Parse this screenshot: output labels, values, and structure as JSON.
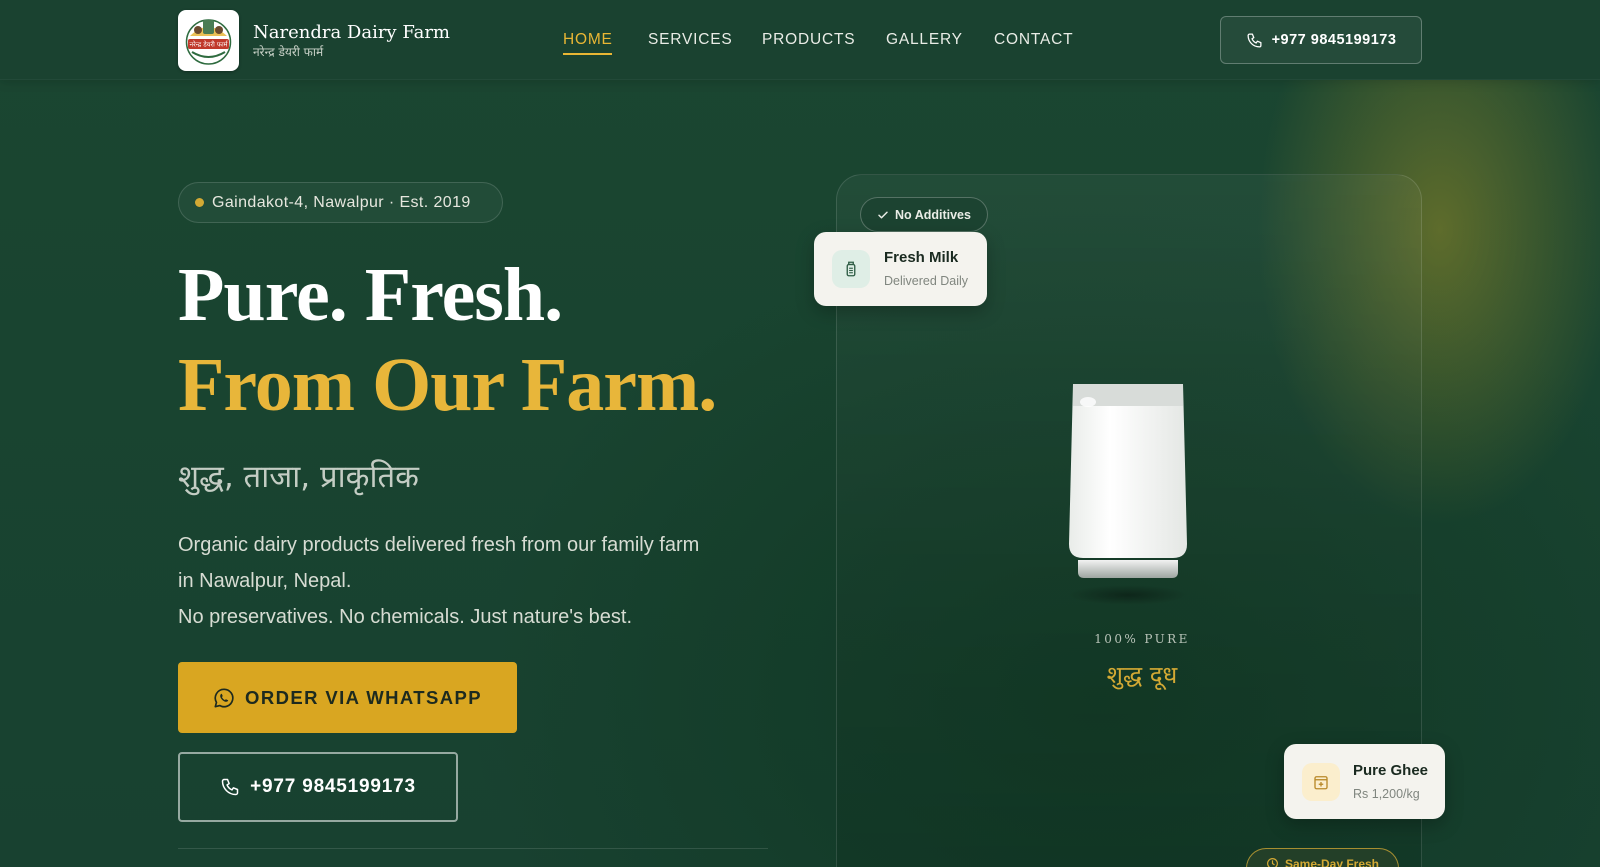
{
  "brand": {
    "name": "Narendra Dairy Farm",
    "subtitle": "नरेन्द्र डेयरी फार्म",
    "logo_text": "नरेन्द्र डेयरी फार्म"
  },
  "nav": {
    "items": [
      {
        "label": "HOME",
        "active": true
      },
      {
        "label": "SERVICES",
        "active": false
      },
      {
        "label": "PRODUCTS",
        "active": false
      },
      {
        "label": "GALLERY",
        "active": false
      },
      {
        "label": "CONTACT",
        "active": false
      }
    ],
    "phone": "+977 9845199173",
    "phone_icon": "phone-icon"
  },
  "hero": {
    "badge": "Gaindakot-4, Nawalpur · Est. 2019",
    "headline_line1": "Pure. Fresh.",
    "headline_line2": "From Our Farm.",
    "tagline_hindi": "शुद्ध, ताजा, प्राकृतिक",
    "paragraph_1": "Organic dairy products delivered fresh from our family farm in Nawalpur, Nepal.",
    "paragraph_2": "No preservatives. No chemicals. Just nature's best.",
    "whatsapp_button": "ORDER VIA WHATSAPP",
    "whatsapp_icon": "whatsapp-icon",
    "phone_button": "+977 9845199173"
  },
  "showcase": {
    "chip_top": "No Additives",
    "chip_top_icon": "check-icon",
    "card_milk": {
      "title": "Fresh Milk",
      "subtitle": "Delivered Daily",
      "icon": "milk-bottle-icon"
    },
    "card_ghee": {
      "title": "Pure Ghee",
      "subtitle": "Rs 1,200/kg",
      "icon": "jar-icon"
    },
    "pure_label": "100% PURE",
    "pure_hindi": "शुद्ध दूध",
    "chip_bottom": "Same-Day Fresh",
    "chip_bottom_icon": "clock-icon"
  },
  "colors": {
    "background": "#18402d",
    "accent_gold": "#e8b63a",
    "button_gold": "#d9a621",
    "card_light": "#f4f3ee"
  }
}
